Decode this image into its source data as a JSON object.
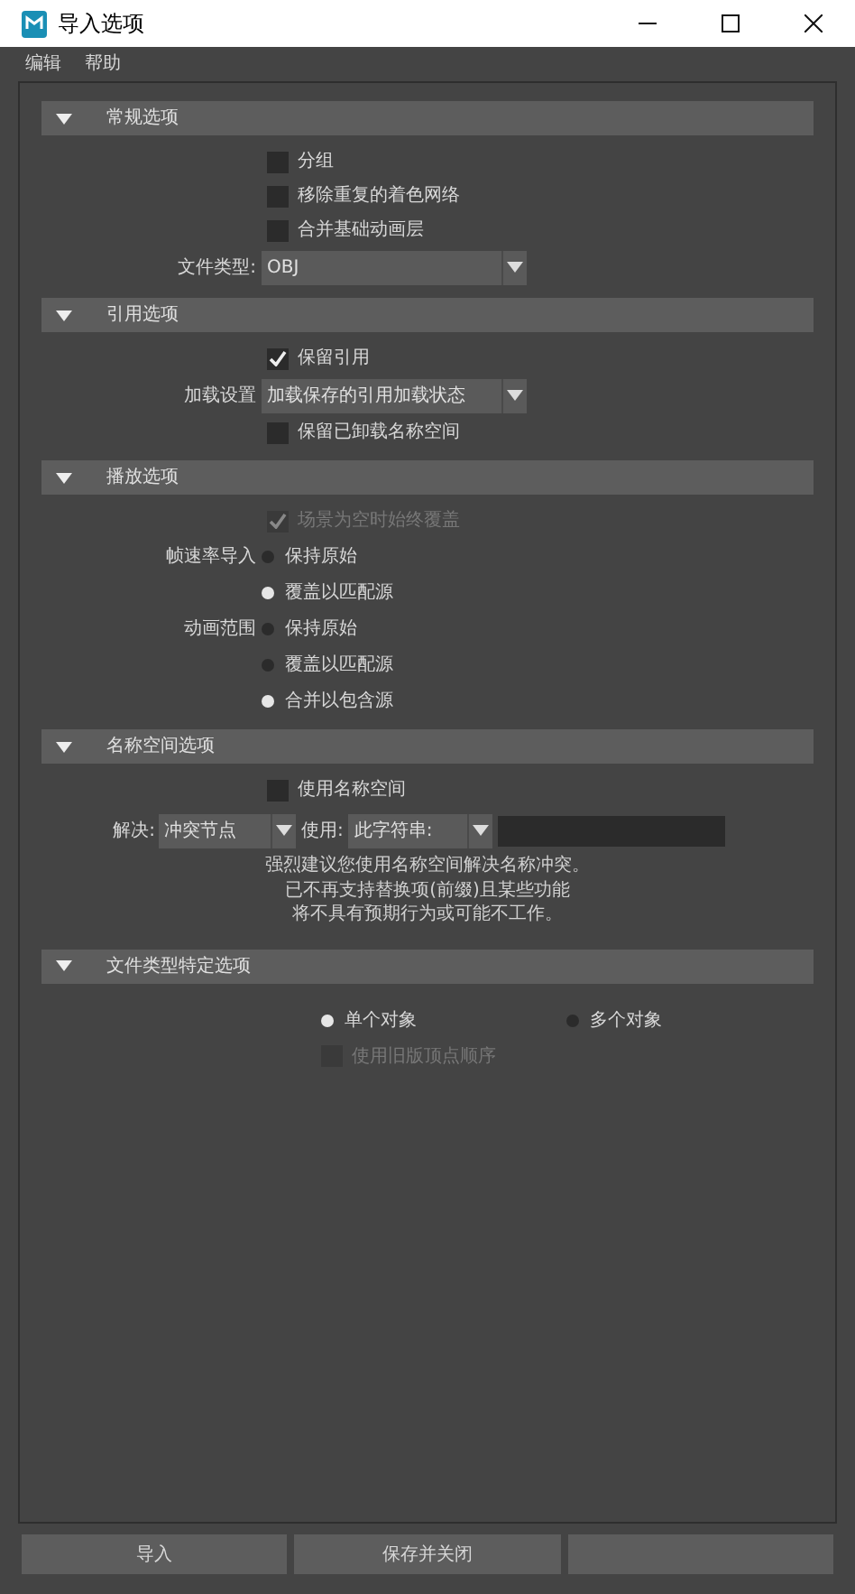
{
  "window": {
    "title": "导入选项"
  },
  "menu": [
    "编辑",
    "帮助"
  ],
  "sections": [
    {
      "title": "常规选项",
      "expanded": true,
      "rows": [
        {
          "kind": "checkbox",
          "label": "分组",
          "checked": false,
          "disabled": false
        },
        {
          "kind": "checkbox",
          "label": "移除重复的着色网络",
          "checked": false,
          "disabled": false
        },
        {
          "kind": "checkbox",
          "label": "合并基础动画层",
          "checked": false,
          "disabled": false
        },
        {
          "kind": "dropdown",
          "label": "文件类型:",
          "value": "OBJ"
        }
      ]
    },
    {
      "title": "引用选项",
      "expanded": true,
      "rows": [
        {
          "kind": "checkbox",
          "label": "保留引用",
          "checked": true,
          "disabled": false
        },
        {
          "kind": "dropdown",
          "label": "加载设置",
          "value": "加载保存的引用加载状态"
        },
        {
          "kind": "checkbox",
          "label": "保留已卸载名称空间",
          "checked": false,
          "disabled": false
        }
      ]
    },
    {
      "title": "播放选项",
      "expanded": true,
      "rows": [
        {
          "kind": "checkbox",
          "label": "场景为空时始终覆盖",
          "checked": true,
          "disabled": true
        },
        {
          "kind": "radio_group",
          "label": "帧速率导入",
          "options": [
            {
              "label": "保持原始",
              "selected": false
            },
            {
              "label": "覆盖以匹配源",
              "selected": true
            }
          ]
        },
        {
          "kind": "radio_group",
          "label": "动画范围",
          "options": [
            {
              "label": "保持原始",
              "selected": false
            },
            {
              "label": "覆盖以匹配源",
              "selected": false
            },
            {
              "label": "合并以包含源",
              "selected": true
            }
          ]
        }
      ]
    },
    {
      "title": "名称空间选项",
      "expanded": true,
      "rows": [
        {
          "kind": "checkbox",
          "label": "使用名称空间",
          "checked": false,
          "disabled": false
        },
        {
          "kind": "resolve",
          "label": "解决:",
          "value": "冲突节点",
          "use_label": "使用:",
          "use_value": "此字符串:"
        },
        {
          "kind": "note",
          "lines": [
            "强烈建议您使用名称空间解决名称冲突。",
            "已不再支持替换项(前缀)且某些功能",
            "将不具有预期行为或可能不工作。"
          ]
        }
      ]
    },
    {
      "title": "文件类型特定选项",
      "expanded": true,
      "rows": [
        {
          "kind": "radio_inline",
          "options": [
            {
              "label": "单个对象",
              "selected": true
            },
            {
              "label": "多个对象",
              "selected": false
            }
          ]
        },
        {
          "kind": "sub_checkbox",
          "label": "使用旧版顶点顺序",
          "checked": false,
          "disabled": true
        }
      ]
    }
  ],
  "buttons": [
    {
      "label": "导入"
    },
    {
      "label": "保存并关闭"
    }
  ]
}
